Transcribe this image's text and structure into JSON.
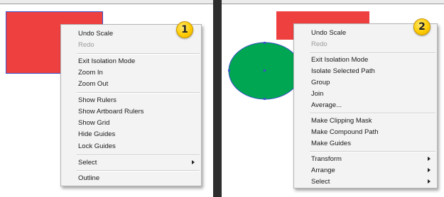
{
  "left_panel": {
    "step_badge": "1",
    "context_menu": {
      "items": [
        {
          "label": "Undo Scale",
          "enabled": true
        },
        {
          "label": "Redo",
          "enabled": false
        },
        {
          "label": "Exit Isolation Mode",
          "enabled": true
        },
        {
          "label": "Zoom In",
          "enabled": true
        },
        {
          "label": "Zoom Out",
          "enabled": true
        },
        {
          "label": "Show Rulers",
          "enabled": true
        },
        {
          "label": "Show Artboard Rulers",
          "enabled": true
        },
        {
          "label": "Show Grid",
          "enabled": true
        },
        {
          "label": "Hide Guides",
          "enabled": true
        },
        {
          "label": "Lock Guides",
          "enabled": true
        },
        {
          "label": "Select",
          "enabled": true,
          "submenu": true
        },
        {
          "label": "Outline",
          "enabled": true
        }
      ]
    }
  },
  "right_panel": {
    "step_badge": "2",
    "context_menu": {
      "items": [
        {
          "label": "Undo Scale",
          "enabled": true
        },
        {
          "label": "Redo",
          "enabled": false
        },
        {
          "label": "Exit Isolation Mode",
          "enabled": true
        },
        {
          "label": "Isolate Selected Path",
          "enabled": true
        },
        {
          "label": "Group",
          "enabled": true
        },
        {
          "label": "Join",
          "enabled": true
        },
        {
          "label": "Average...",
          "enabled": true
        },
        {
          "label": "Make Clipping Mask",
          "enabled": true
        },
        {
          "label": "Make Compound Path",
          "enabled": true
        },
        {
          "label": "Make Guides",
          "enabled": true
        },
        {
          "label": "Transform",
          "enabled": true,
          "submenu": true
        },
        {
          "label": "Arrange",
          "enabled": true,
          "submenu": true
        },
        {
          "label": "Select",
          "enabled": true,
          "submenu": true
        }
      ]
    }
  },
  "colors": {
    "shape_red": "#ef4040",
    "shape_green": "#00a651",
    "selection_blue": "#3a52c8",
    "badge_yellow": "#ffcc00",
    "divider": "#2d2d2d",
    "menu_background": "#f3f3f3"
  },
  "icons": {
    "submenu_arrow": "triangle-right",
    "step_badge": "numbered-circle"
  }
}
